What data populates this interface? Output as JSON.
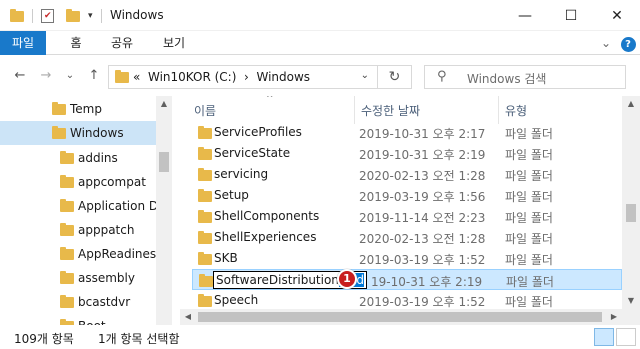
{
  "window": {
    "title": "Windows",
    "minimize": "—",
    "maximize": "☐",
    "close": "✕"
  },
  "ribbon": {
    "tabs": [
      "파일",
      "홈",
      "공유",
      "보기"
    ],
    "collapse_icon": "⌄",
    "help_icon": "?"
  },
  "nav": {
    "back": "←",
    "forward": "→",
    "recent": "⌄",
    "up": "↑"
  },
  "address": {
    "prefix": "«",
    "crumbs": [
      "Win10KOR (C:)",
      "Windows"
    ],
    "separator": "›",
    "dropdown": "⌄",
    "refresh": "↻"
  },
  "search": {
    "placeholder": "Windows 검색",
    "icon": "⚲"
  },
  "navpane": {
    "items": [
      {
        "label": "Temp",
        "level": 1,
        "selected": false
      },
      {
        "label": "Windows",
        "level": 1,
        "selected": true
      },
      {
        "label": "addins",
        "level": 2,
        "selected": false
      },
      {
        "label": "appcompat",
        "level": 2,
        "selected": false
      },
      {
        "label": "Application Da",
        "level": 2,
        "selected": false
      },
      {
        "label": "apppatch",
        "level": 2,
        "selected": false
      },
      {
        "label": "AppReadiness",
        "level": 2,
        "selected": false
      },
      {
        "label": "assembly",
        "level": 2,
        "selected": false
      },
      {
        "label": "bcastdvr",
        "level": 2,
        "selected": false
      },
      {
        "label": "Boot",
        "level": 2,
        "selected": false
      }
    ]
  },
  "columns": {
    "name": "이름",
    "date": "수정한 날짜",
    "type": "유형",
    "sort_icon": "^"
  },
  "files": [
    {
      "name": "ServiceProfiles",
      "date": "2019-10-31 오후 2:17",
      "type": "파일 폴더"
    },
    {
      "name": "ServiceState",
      "date": "2019-10-31 오후 2:19",
      "type": "파일 폴더"
    },
    {
      "name": "servicing",
      "date": "2020-02-13 오전 1:28",
      "type": "파일 폴더"
    },
    {
      "name": "Setup",
      "date": "2019-03-19 오후 1:56",
      "type": "파일 폴더"
    },
    {
      "name": "ShellComponents",
      "date": "2019-11-14 오전 2:23",
      "type": "파일 폴더"
    },
    {
      "name": "ShellExperiences",
      "date": "2020-02-13 오전 1:28",
      "type": "파일 폴더"
    },
    {
      "name": "SKB",
      "date": "2019-03-19 오후 1:52",
      "type": "파일 폴더"
    },
    {
      "name": "SoftwareDistribution",
      "date": "2019-10-31 오후 2:19",
      "type": "파일 폴더"
    },
    {
      "name": "Speech",
      "date": "2019-03-19 오후 1:52",
      "type": "파일 폴더"
    }
  ],
  "rename": {
    "base": "SoftwareDistribution",
    "highlighted": "-Old",
    "badge": "1",
    "date_visible": "19-10-31 오후 2:19"
  },
  "status": {
    "count": "109개 항목",
    "selected": "1개 항목 선택함"
  },
  "colors": {
    "accent": "#1979ca",
    "selection": "#cce8ff",
    "folder": "#e8b94a",
    "badge": "#c81e1e"
  }
}
